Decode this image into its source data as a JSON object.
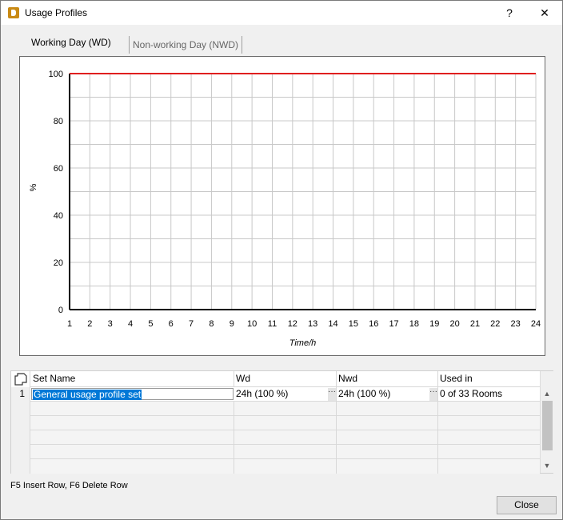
{
  "window": {
    "title": "Usage Profiles",
    "help_label": "?",
    "close_label": "✕"
  },
  "tabs": [
    {
      "label": "Working Day (WD)",
      "active": true
    },
    {
      "label": "Non-working Day (NWD)",
      "active": false
    }
  ],
  "chart_data": {
    "type": "line",
    "xlabel": "Time/h",
    "ylabel": "%",
    "xlim": [
      1,
      24
    ],
    "ylim": [
      0,
      100
    ],
    "x_ticks": [
      1,
      2,
      3,
      4,
      5,
      6,
      7,
      8,
      9,
      10,
      11,
      12,
      13,
      14,
      15,
      16,
      17,
      18,
      19,
      20,
      21,
      22,
      23,
      24
    ],
    "y_ticks": [
      0,
      20,
      40,
      60,
      80,
      100
    ],
    "grid": true,
    "series": [
      {
        "x": [
          1,
          24
        ],
        "values": [
          100,
          100
        ],
        "color": "#e01e1e"
      }
    ],
    "axis_color": "#000000",
    "grid_color": "#c8c8c8"
  },
  "table": {
    "columns": [
      "Set Name",
      "Wd",
      "Nwd",
      "Used in"
    ],
    "rows": [
      {
        "num": "1",
        "set_name": "General usage profile set",
        "wd": "24h (100 %)",
        "nwd": "24h (100 %)",
        "used_in": "0 of 33 Rooms"
      }
    ],
    "ellipsis_label": "···",
    "scroll_up": "▲",
    "scroll_down": "▼"
  },
  "footer": {
    "hint": "F5 Insert Row, F6 Delete Row",
    "close_button": "Close"
  },
  "colors": {
    "selection": "#0078d7",
    "brand_icon": "#c98a14"
  }
}
